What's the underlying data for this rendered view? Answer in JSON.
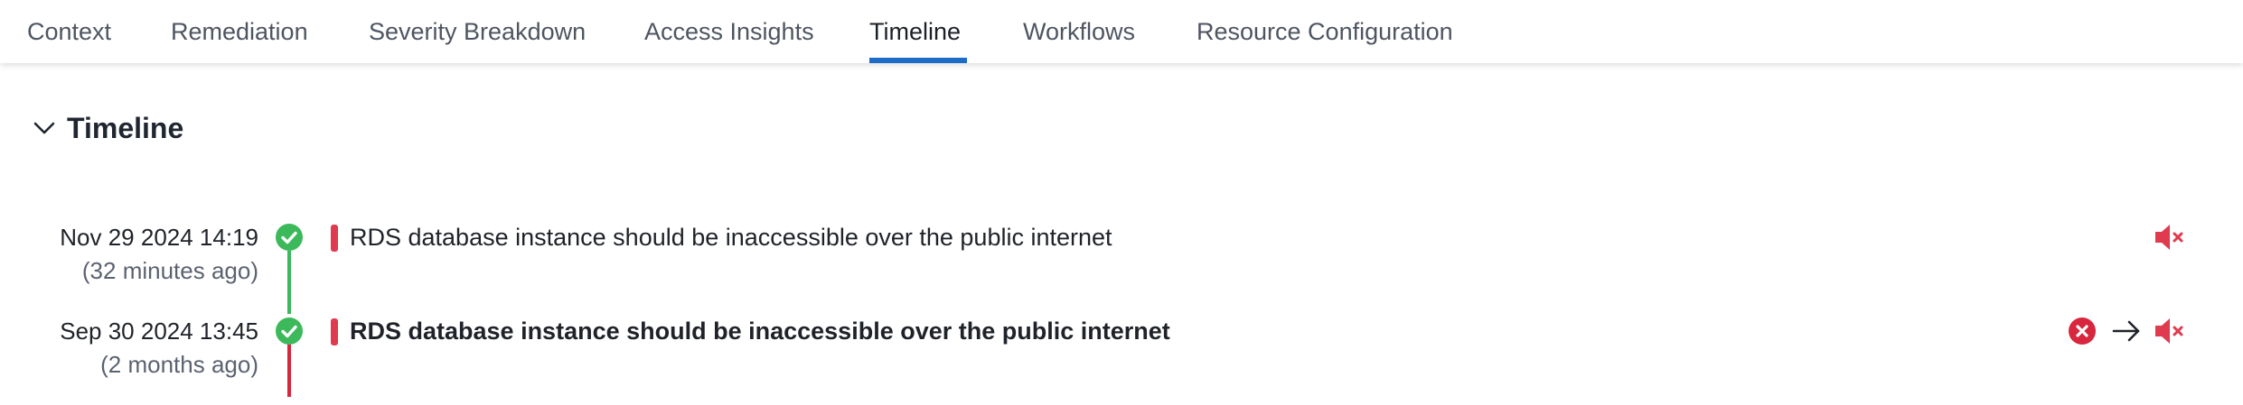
{
  "tabs": [
    {
      "label": "Context",
      "active": false
    },
    {
      "label": "Remediation",
      "active": false
    },
    {
      "label": "Severity Breakdown",
      "active": false
    },
    {
      "label": "Access Insights",
      "active": false
    },
    {
      "label": "Timeline",
      "active": true
    },
    {
      "label": "Workflows",
      "active": false
    },
    {
      "label": "Resource Configuration",
      "active": false
    }
  ],
  "section": {
    "title": "Timeline",
    "expanded": true,
    "chevron_icon": "chevron-down-icon"
  },
  "colors": {
    "accent": "#1c6bc7",
    "pass_green": "#3cb95a",
    "fail_red": "#e03a4e",
    "severity_critical": "#e03a4e"
  },
  "timeline": [
    {
      "date": "Nov 29 2024 14:19",
      "relative": "(32 minutes ago)",
      "status": "passed",
      "status_icon": "check-circle-icon",
      "severity": "critical",
      "message": "RDS database instance should be inaccessible over the public internet",
      "bold": false,
      "actions": [
        "mute-icon"
      ]
    },
    {
      "date": "Sep 30 2024 13:45",
      "relative": "(2 months ago)",
      "status": "passed",
      "status_icon": "check-circle-icon",
      "severity": "critical",
      "message": "RDS database instance should be inaccessible over the public internet",
      "bold": true,
      "actions": [
        "failed-circle-icon",
        "arrow-right-icon",
        "mute-icon"
      ]
    }
  ]
}
